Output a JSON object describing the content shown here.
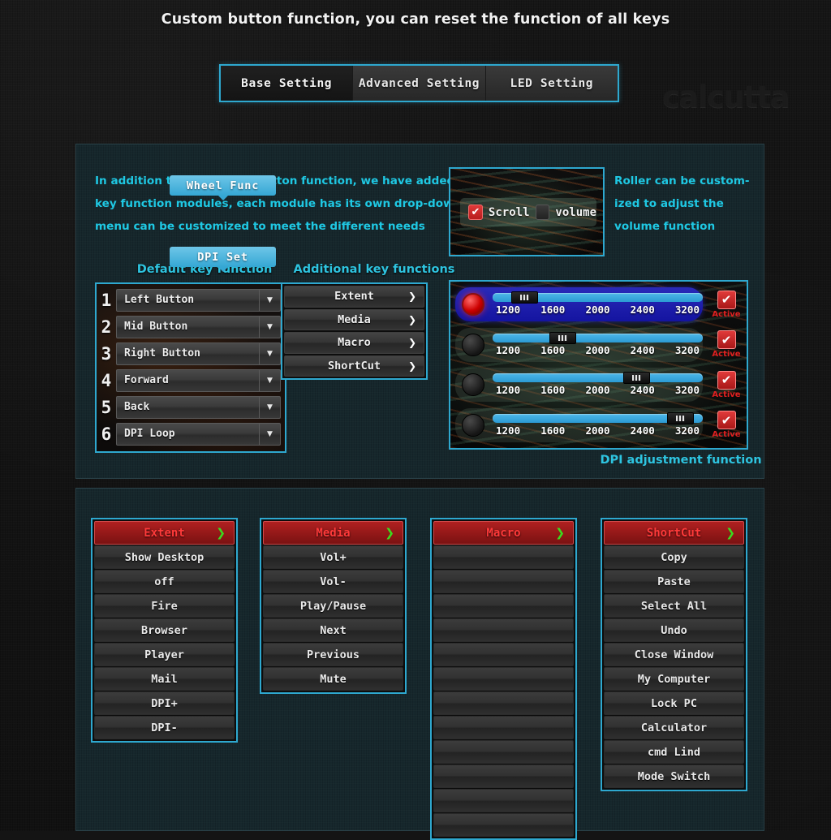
{
  "header": {
    "title": "Custom button function, you can reset the function of all keys",
    "watermark": "calcutta",
    "tabs": [
      {
        "label": "Base Setting",
        "active": true
      },
      {
        "label": "Advanced Setting",
        "active": false
      },
      {
        "label": "LED Setting",
        "active": false
      }
    ]
  },
  "top_panel": {
    "description_lines": [
      "In addition to the default button function, we have added  four",
      "key function modules, each module has its own drop-down",
      "menu can be customized to meet the different needs"
    ],
    "roller_note_lines": [
      "Roller can be custom-",
      "ized to adjust the",
      "volume function"
    ],
    "default_keys": {
      "title": "Default key function",
      "rows": [
        {
          "num": "1",
          "value": "Left Button"
        },
        {
          "num": "2",
          "value": "Mid Button"
        },
        {
          "num": "3",
          "value": "Right Button"
        },
        {
          "num": "4",
          "value": "Forward"
        },
        {
          "num": "5",
          "value": "Back"
        },
        {
          "num": "6",
          "value": "DPI Loop"
        }
      ],
      "arrow_icon": "▼"
    },
    "additional_keys": {
      "title": "Additional key functions",
      "items": [
        "Extent",
        "Media",
        "Macro",
        "ShortCut"
      ],
      "chevron_icon": "❯"
    },
    "wheel": {
      "chip_wheel": "Wheel Func",
      "chip_dpi": "DPI Set",
      "scroll_label": "Scroll",
      "scroll_checked": true,
      "volume_label": "volume",
      "volume_checked": false,
      "check_glyph": "✔"
    },
    "dpi": {
      "caption": "DPI adjustment function",
      "tick_labels": [
        "1200",
        "1600",
        "2000",
        "2400",
        "3200"
      ],
      "active_label": "Active",
      "check_glyph": "✔",
      "rows": [
        {
          "selected": true,
          "led_on": true,
          "handle_pct": 9,
          "active": true
        },
        {
          "selected": false,
          "led_on": false,
          "handle_pct": 27,
          "active": true
        },
        {
          "selected": false,
          "led_on": false,
          "handle_pct": 62,
          "active": true
        },
        {
          "selected": false,
          "led_on": false,
          "handle_pct": 83,
          "active": true
        }
      ]
    }
  },
  "bottom_panel": {
    "lists": [
      {
        "title": "Extent",
        "items": [
          "Show Desktop",
          "off",
          "Fire",
          "Browser",
          "Player",
          "Mail",
          "DPI+",
          "DPI-"
        ]
      },
      {
        "title": "Media",
        "items": [
          "Vol+",
          "Vol-",
          "Play/Pause",
          "Next",
          "Previous",
          "Mute"
        ]
      },
      {
        "title": "Macro",
        "items": [
          "",
          "",
          "",
          "",
          "",
          "",
          "",
          "",
          "",
          "",
          "",
          ""
        ]
      },
      {
        "title": "ShortCut",
        "items": [
          "Copy",
          "Paste",
          "Select All",
          "Undo",
          "Close Window",
          "My Computer",
          "Lock PC",
          "Calculator",
          "cmd Lind",
          "Mode Switch"
        ]
      }
    ],
    "chevron_icon": "❯"
  },
  "colors": {
    "accent_cyan": "#2ea8cf",
    "text_cyan": "#1fc8e3",
    "red": "#e03a3a",
    "green": "#3bdc1e",
    "panel_bg": "#16272c"
  }
}
